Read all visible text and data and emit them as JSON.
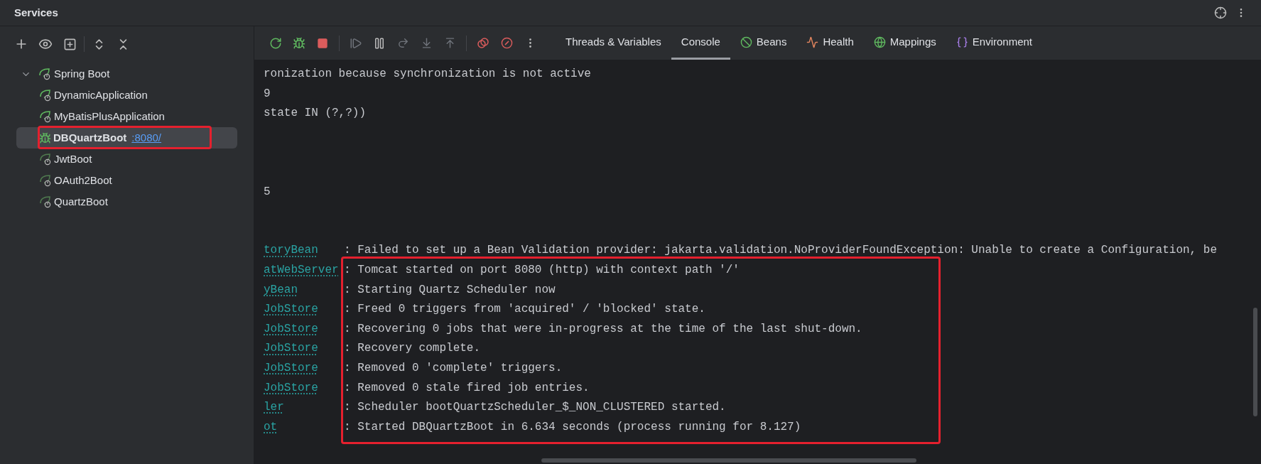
{
  "panel_title": "Services",
  "tree": [
    {
      "label": "Spring Boot",
      "expanded": true,
      "children": [
        {
          "label": "DynamicApplication",
          "kind": "app",
          "selected": false,
          "annotated": false
        },
        {
          "label": "MyBatisPlusApplication",
          "kind": "app",
          "selected": false,
          "annotated": false
        },
        {
          "label": "DBQuartzBoot",
          "link": ":8080/",
          "kind": "debug",
          "selected": true,
          "annotated": true
        },
        {
          "label": "JwtBoot",
          "kind": "app",
          "selected": false,
          "annotated": false
        },
        {
          "label": "OAuth2Boot",
          "kind": "app",
          "selected": false,
          "annotated": false
        },
        {
          "label": "QuartzBoot",
          "kind": "app",
          "selected": false,
          "annotated": false
        }
      ]
    }
  ],
  "tabs": [
    {
      "label": "Threads & Variables",
      "selected": false
    },
    {
      "label": "Console",
      "selected": true
    },
    {
      "label": "Beans",
      "selected": false
    },
    {
      "label": "Health",
      "selected": false
    },
    {
      "label": "Mappings",
      "selected": false
    },
    {
      "label": "Environment",
      "selected": false
    }
  ],
  "console_lines": [
    {
      "kind": "text",
      "text": "ronization because synchronization is not active"
    },
    {
      "kind": "text",
      "text": "9"
    },
    {
      "kind": "text",
      "text": "state IN (?,?))"
    },
    {
      "kind": "blank"
    },
    {
      "kind": "blank"
    },
    {
      "kind": "blank"
    },
    {
      "kind": "text",
      "text": "5"
    },
    {
      "kind": "blank"
    },
    {
      "kind": "blank"
    },
    {
      "kind": "log",
      "logger": "toryBean",
      "message": ": Failed to set up a Bean Validation provider: jakarta.validation.NoProviderFoundException: Unable to create a Configuration, be"
    },
    {
      "kind": "highlighted_group",
      "lines": [
        {
          "logger": "atWebServer",
          "message": ": Tomcat started on port 8080 (http) with context path '/'"
        },
        {
          "logger": "yBean",
          "message": ": Starting Quartz Scheduler now"
        },
        {
          "logger": "JobStore",
          "message": ": Freed 0 triggers from 'acquired' / 'blocked' state."
        },
        {
          "logger": "JobStore",
          "message": ": Recovering 0 jobs that were in-progress at the time of the last shut-down."
        },
        {
          "logger": "JobStore",
          "message": ": Recovery complete."
        },
        {
          "logger": "JobStore",
          "message": ": Removed 0 'complete' triggers."
        },
        {
          "logger": "JobStore",
          "message": ": Removed 0 stale fired job entries."
        },
        {
          "logger": "ler",
          "message": ": Scheduler bootQuartzScheduler_$_NON_CLUSTERED started."
        },
        {
          "logger": "ot",
          "message": ": Started DBQuartzBoot in 6.634 seconds (process running for 8.127)"
        }
      ]
    }
  ]
}
